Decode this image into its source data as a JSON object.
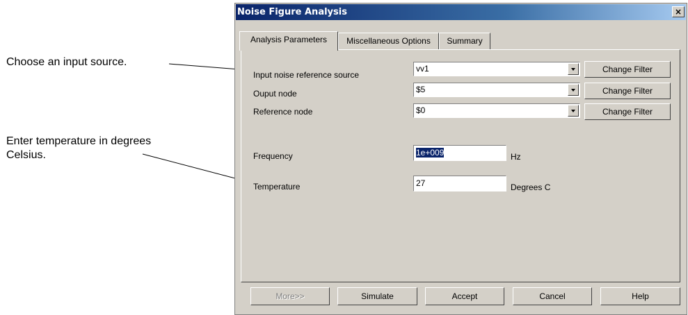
{
  "callouts": {
    "input_source": "Choose an input source.",
    "temperature_line1": "Enter temperature in degrees",
    "temperature_line2": "Celsius."
  },
  "dialog": {
    "title": "Noise Figure Analysis",
    "close_glyph": "×",
    "tabs": [
      {
        "label": "Analysis Parameters",
        "active": true
      },
      {
        "label": "Miscellaneous Options",
        "active": false
      },
      {
        "label": "Summary",
        "active": false
      }
    ],
    "nodes": [
      {
        "label": "Input noise reference source",
        "value": "vv1",
        "button": "Change Filter"
      },
      {
        "label": "Ouput node",
        "value": "$5",
        "button": "Change Filter"
      },
      {
        "label": "Reference node",
        "value": "$0",
        "button": "Change Filter"
      }
    ],
    "frequency": {
      "label": "Frequency",
      "value": "1e+009",
      "unit": "Hz"
    },
    "temperature": {
      "label": "Temperature",
      "value": "27",
      "unit": "Degrees C"
    },
    "footer": {
      "more": "More>>",
      "simulate": "Simulate",
      "accept": "Accept",
      "cancel": "Cancel",
      "help": "Help"
    }
  }
}
